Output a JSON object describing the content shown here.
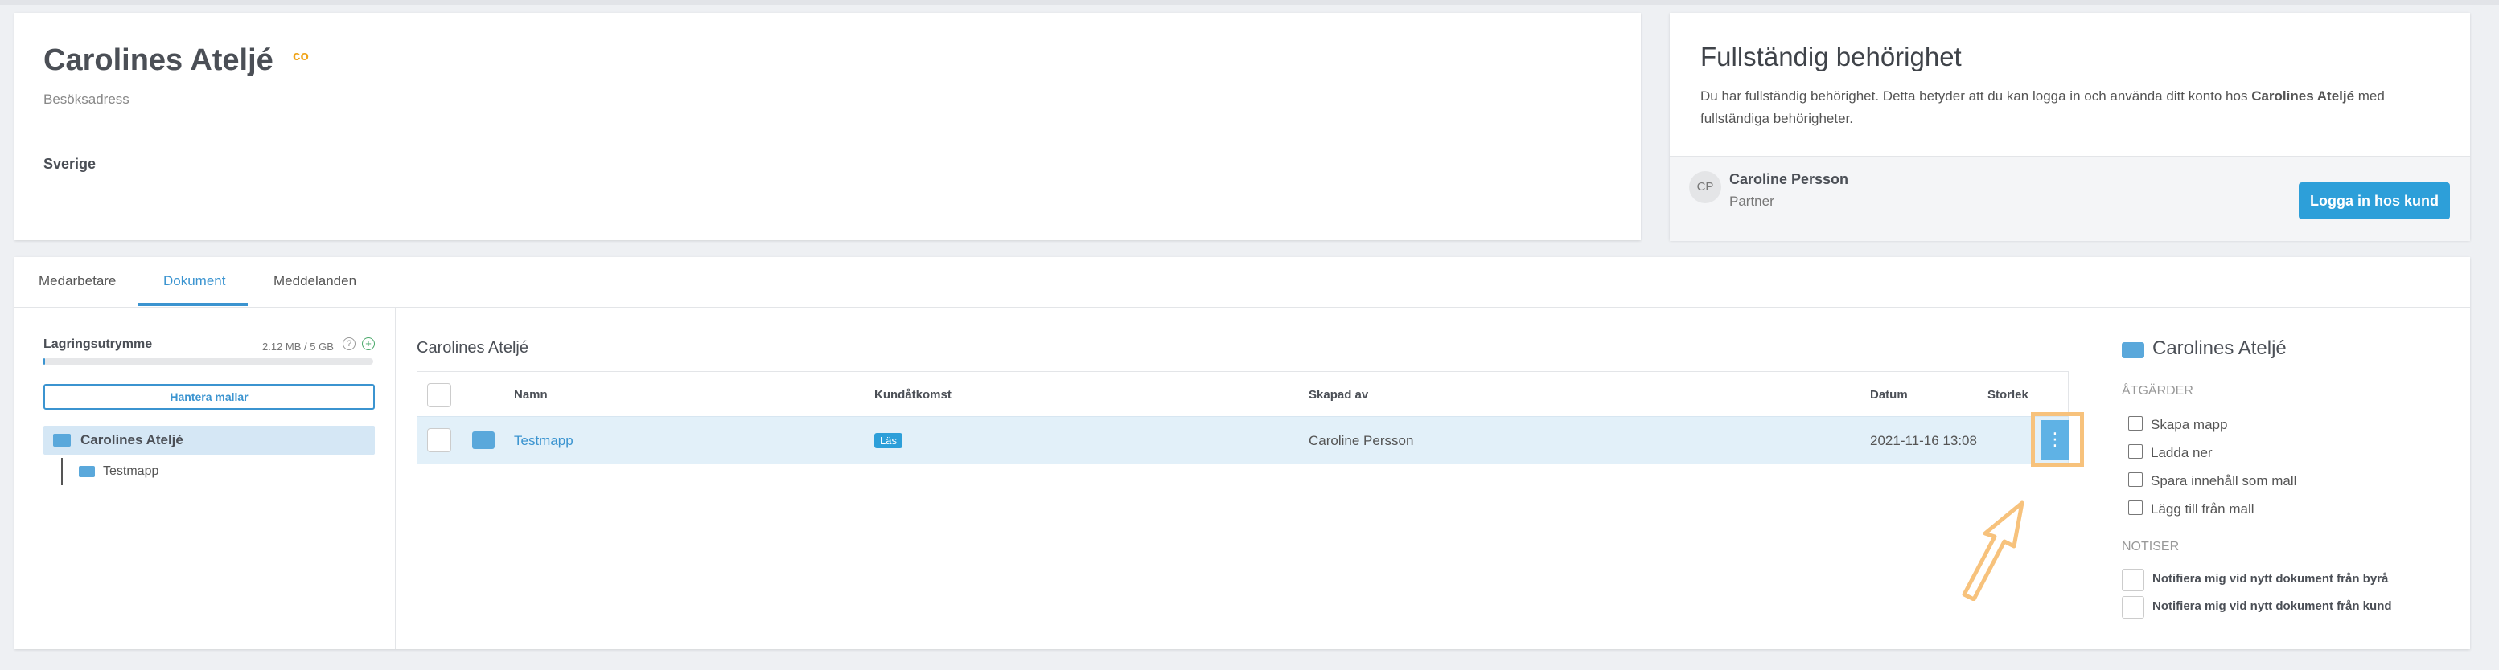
{
  "company": {
    "name": "Carolines Ateljé",
    "badge": "co",
    "visit_address_label": "Besöksadress",
    "country": "Sverige"
  },
  "permission": {
    "title": "Fullständig behörighet",
    "description_pre": "Du har fullständig behörighet. Detta betyder att du kan logga in och använda ditt konto hos ",
    "description_company": "Carolines Ateljé",
    "description_post": " med fullständiga behörigheter.",
    "user_initials": "CP",
    "user_name": "Caroline Persson",
    "user_role": "Partner",
    "login_button": "Logga in hos kund"
  },
  "tabs": [
    {
      "label": "Medarbetare",
      "active": false
    },
    {
      "label": "Dokument",
      "active": true
    },
    {
      "label": "Meddelanden",
      "active": false
    }
  ],
  "sidebar": {
    "storage_label": "Lagringsutrymme",
    "storage_value": "2.12 MB / 5 GB",
    "storage_used_fraction": 0.0004,
    "templates_button": "Hantera mallar",
    "tree_root": "Carolines Ateljé",
    "tree_child": "Testmapp"
  },
  "file_list": {
    "heading": "Carolines Ateljé",
    "columns": [
      "Namn",
      "Kundåtkomst",
      "Skapad av",
      "Datum",
      "Storlek"
    ],
    "rows": [
      {
        "name": "Testmapp",
        "access": "Läs",
        "created_by": "Caroline Persson",
        "date": "2021-11-16 13:08",
        "size": ""
      }
    ],
    "row_menu_icon": "more-vertical-icon"
  },
  "actions_panel": {
    "title": "Carolines Ateljé",
    "actions_title": "ÅTGÄRDER",
    "actions": [
      {
        "label": "Skapa mapp",
        "icon": "folder-plus-icon"
      },
      {
        "label": "Ladda ner",
        "icon": "download-icon"
      },
      {
        "label": "Spara innehåll som mall",
        "icon": "copy-icon"
      },
      {
        "label": "Lägg till från mall",
        "icon": "template-icon"
      }
    ],
    "notify_title": "NOTISER",
    "notifications": [
      {
        "label": "Notifiera mig vid nytt dokument från byrå",
        "checked": false
      },
      {
        "label": "Notifiera mig vid nytt dokument från kund",
        "checked": false
      }
    ]
  },
  "colors": {
    "accent": "#3b94d0",
    "button": "#2d9fd9",
    "highlight": "#f7c27c",
    "badge": "#f0a419"
  }
}
